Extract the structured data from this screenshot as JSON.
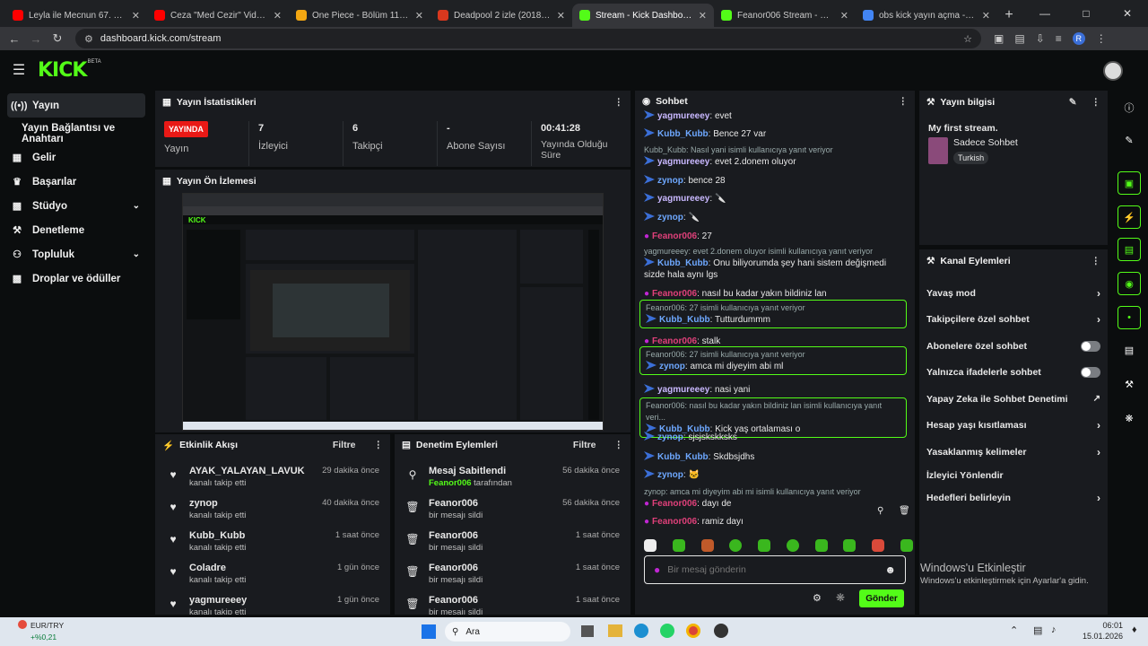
{
  "browser": {
    "tabs": [
      {
        "label": "Leyla ile Mecnun 67. Bölüm - Yo",
        "fav": "#ff0000"
      },
      {
        "label": "Ceza \"Med Cezir\" Videoklip",
        "fav": "#ff0000"
      },
      {
        "label": "One Piece - Bölüm 1170 - Rüya",
        "fav": "#f3a712"
      },
      {
        "label": "Deadpool 2 izle (2018) | HDFilm",
        "fav": "#d9381e"
      },
      {
        "label": "Stream - Kick Dashboard",
        "fav": "#53fc18"
      },
      {
        "label": "Feanor006 Stream - Watch Live",
        "fav": "#53fc18"
      },
      {
        "label": "obs kick yayın açma - Google'd",
        "fav": "#4285f4"
      }
    ],
    "url": "dashboard.kick.com/stream",
    "profile_initial": "R"
  },
  "app": {
    "logo": "KICK",
    "beta": "BETA"
  },
  "sidebar": {
    "items": [
      {
        "label": "Yayın",
        "icon": "broadcast-icon"
      },
      {
        "label": "Yayın Bağlantısı ve Anahtarı",
        "icon": ""
      },
      {
        "label": "Gelir",
        "icon": "chart-icon"
      },
      {
        "label": "Başarılar",
        "icon": "trophy-icon"
      },
      {
        "label": "Stüdyo",
        "icon": "studio-icon"
      },
      {
        "label": "Denetleme",
        "icon": "wrench-icon"
      },
      {
        "label": "Topluluk",
        "icon": "community-icon"
      },
      {
        "label": "Droplar ve ödüller",
        "icon": "gift-icon"
      }
    ]
  },
  "stats": {
    "title": "Yayın İstatistikleri",
    "badge": "YAYINDA",
    "badge_label": "Yayın",
    "items": [
      {
        "value": "7",
        "label": "İzleyici"
      },
      {
        "value": "6",
        "label": "Takipçi"
      },
      {
        "value": "-",
        "label": "Abone Sayısı"
      },
      {
        "value": "00:41:28",
        "label": "Yayında Olduğu Süre"
      }
    ]
  },
  "preview": {
    "title": "Yayın Ön İzlemesi"
  },
  "activity": {
    "title": "Etkinlik Akışı",
    "filter": "Filtre",
    "items": [
      {
        "name": "AYAK_YALAYAN_LAVUK",
        "sub": "kanalı takip etti",
        "time": "29 dakika önce"
      },
      {
        "name": "zynop",
        "sub": "kanalı takip etti",
        "time": "40 dakika önce"
      },
      {
        "name": "Kubb_Kubb",
        "sub": "kanalı takip etti",
        "time": "1 saat önce"
      },
      {
        "name": "Coladre",
        "sub": "kanalı takip etti",
        "time": "1 gün önce"
      },
      {
        "name": "yagmureeey",
        "sub": "kanalı takip etti",
        "time": "1 gün önce"
      }
    ]
  },
  "moderation": {
    "title": "Denetim Eylemleri",
    "filter": "Filtre",
    "items": [
      {
        "name": "Mesaj Sabitlendi",
        "by": "Feanor006",
        "sub": "tarafından",
        "time": "56 dakika önce"
      },
      {
        "name": "Feanor006",
        "sub": "bir mesajı sildi",
        "time": "56 dakika önce"
      },
      {
        "name": "Feanor006",
        "sub": "bir mesajı sildi",
        "time": "1 saat önce"
      },
      {
        "name": "Feanor006",
        "sub": "bir mesajı sildi",
        "time": "1 saat önce"
      },
      {
        "name": "Feanor006",
        "sub": "bir mesajı sildi",
        "time": "1 saat önce"
      }
    ]
  },
  "chat": {
    "title": "Sohbet",
    "placeholder": "Bir mesaj gönderin",
    "send": "Gönder",
    "colors": {
      "blue": "#6ea8ff",
      "pink": "#e0407a",
      "green": "#53fc18"
    },
    "messages": [
      {
        "user": "yagmureeey",
        "text": "evet",
        "color": "#c9b8ff"
      },
      {
        "user": "Kubb_Kubb",
        "text": "Bence 27 var",
        "color": "#6ea8ff"
      },
      {
        "reply": "Kubb_Kubb: Nasıl yani isimli kullanıcıya yanıt veriyor",
        "user": "yagmureeey",
        "text": "evet 2.donem oluyor",
        "color": "#c9b8ff"
      },
      {
        "user": "zynop",
        "text": "bence 28",
        "color": "#6ea8ff"
      },
      {
        "user": "yagmureeey",
        "text": "🔪",
        "color": "#c9b8ff"
      },
      {
        "user": "zynop",
        "text": "🔪",
        "color": "#6ea8ff"
      },
      {
        "user": "Feanor006",
        "text": "27",
        "color": "#e0407a"
      },
      {
        "reply": "yagmureeey: evet 2.donem oluyor isimli kullanıcıya yanıt veriyor",
        "user": "Kubb_Kubb",
        "text": "Onu biliyorumda şey hani sistem değişmedi sizde hala aynı lgs",
        "color": "#6ea8ff"
      },
      {
        "user": "Feanor006",
        "text": "nasıl bu kadar yakın bildiniz lan",
        "color": "#e0407a"
      },
      {
        "reply": "Feanor006: 27 isimli kullanıcıya yanıt veriyor",
        "user": "Kubb_Kubb",
        "text": "Tutturdummm",
        "color": "#6ea8ff"
      },
      {
        "user": "Feanor006",
        "text": "stalk",
        "color": "#e0407a"
      },
      {
        "reply": "Feanor006: 27 isimli kullanıcıya yanıt veriyor",
        "user": "zynop",
        "text": "amca mi diyeyim abi ml",
        "color": "#6ea8ff"
      },
      {
        "user": "yagmureeey",
        "text": "nasi yani",
        "color": "#c9b8ff"
      },
      {
        "reply": "Feanor006: nasıl bu kadar yakın bildiniz lan isimli kullanıcıya yanıt veri...",
        "user": "Kubb_Kubb",
        "text": "Kick yaş ortalaması o",
        "color": "#6ea8ff"
      },
      {
        "user": "zynop",
        "text": "sjsjskskksks",
        "color": "#6ea8ff"
      },
      {
        "user": "Kubb_Kubb",
        "text": "Skdbsjdhs",
        "color": "#6ea8ff"
      },
      {
        "user": "zynop",
        "text": "🐱",
        "color": "#6ea8ff"
      },
      {
        "reply": "zynop: amca mi diyeyim abi mi isimli kullanıcıya yanıt veriyor",
        "user": "Feanor006",
        "text": "dayı de",
        "color": "#e0407a"
      },
      {
        "user": "Feanor006",
        "text": "ramiz dayı",
        "color": "#e0407a"
      }
    ]
  },
  "info": {
    "title": "Yayın bilgisi",
    "stream_title": "My first stream.",
    "category": "Sadece Sohbet",
    "language": "Turkish"
  },
  "channel": {
    "title": "Kanal Eylemleri",
    "actions": [
      {
        "label": "Yavaş mod",
        "type": "chevron"
      },
      {
        "label": "Takipçilere özel sohbet",
        "type": "chevron"
      },
      {
        "label": "Abonelere özel sohbet",
        "type": "toggle"
      },
      {
        "label": "Yalnızca ifadelerle sohbet",
        "type": "toggle"
      },
      {
        "label": "Yapay Zeka ile Sohbet Denetimi",
        "type": "external"
      },
      {
        "label": "Hesap yaşı kısıtlaması",
        "type": "chevron"
      },
      {
        "label": "Yasaklanmış kelimeler",
        "type": "chevron"
      },
      {
        "label": "İzleyici Yönlendir",
        "type": "none"
      },
      {
        "label": "Hedefleri belirleyin",
        "type": "chevron"
      }
    ]
  },
  "watermark": {
    "title": "Windows'u Etkinleştir",
    "sub": "Windows'u etkinleştirmek için Ayarlar'a gidin."
  },
  "taskbar": {
    "ticker": "EUR/TRY",
    "ticker_change": "+%0,21",
    "search": "Ara",
    "time": "06:01",
    "date": "15.01.2026"
  }
}
